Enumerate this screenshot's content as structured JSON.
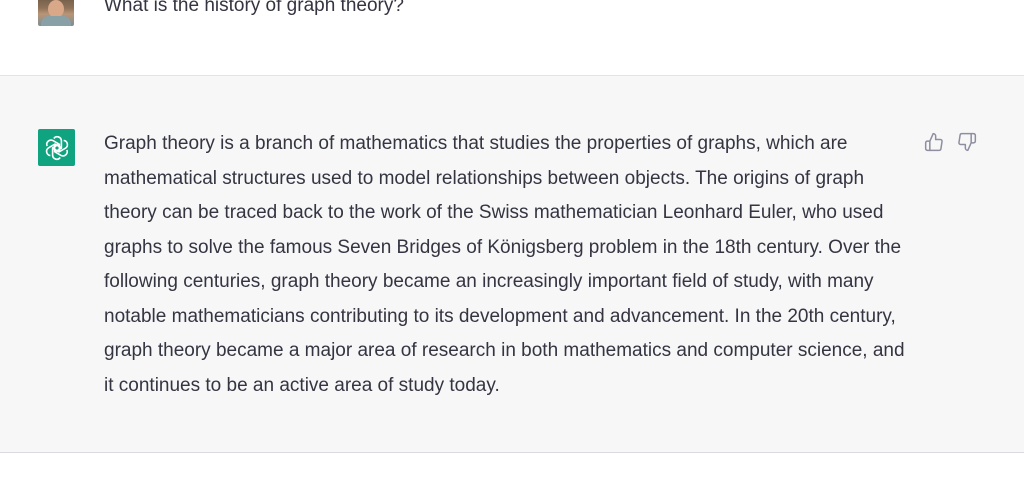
{
  "conversation": {
    "user_message": "What is the history of graph theory?",
    "assistant_message": "Graph theory is a branch of mathematics that studies the properties of graphs, which are mathematical structures used to model relationships between objects. The origins of graph theory can be traced back to the work of the Swiss mathematician Leonhard Euler, who used graphs to solve the famous Seven Bridges of Königsberg problem in the 18th century. Over the following centuries, graph theory became an increasingly important field of study, with many notable mathematicians contributing to its development and advancement. In the 20th century, graph theory became a major area of research in both mathematics and computer science, and it continues to be an active area of study today."
  },
  "icons": {
    "user_avatar": "user-avatar",
    "assistant_avatar": "openai-logo-icon",
    "feedback": [
      "thumbs-up-icon",
      "thumbs-down-icon"
    ]
  },
  "colors": {
    "assistant_avatar_bg": "#10a37f",
    "assistant_row_bg": "#f7f7f8",
    "text": "#343541",
    "icon": "#8e8ea0"
  }
}
